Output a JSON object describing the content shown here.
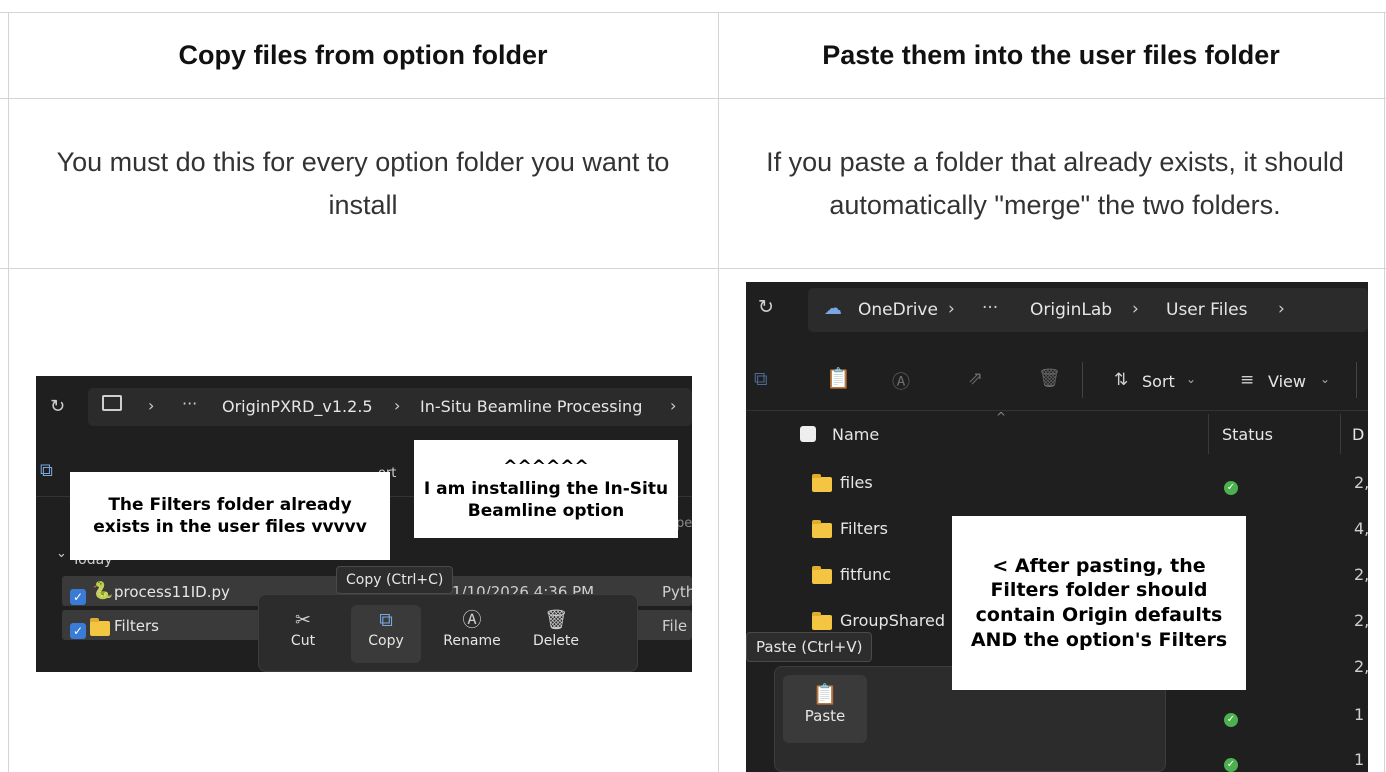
{
  "headers": {
    "left": "Copy files from option folder",
    "right": "Paste them into the user files folder"
  },
  "descriptions": {
    "left": "You must do this for every option folder you want to install",
    "right": "If you paste a folder that already exists, it should automatically \"merge\" the two folders."
  },
  "left_shot": {
    "breadcrumb": [
      "OriginPXRD_v1.2.5",
      "In-Situ Beamline Processing"
    ],
    "ellipsis": "···",
    "refresh_icon": "refresh-icon",
    "monitor_icon": "monitor-icon",
    "group_label": "Today",
    "rows": [
      {
        "name": "process11ID.py",
        "date": "1/10/2026 4:36 PM",
        "type": "Pyth"
      },
      {
        "name": "Filters",
        "date": "",
        "type": "File"
      }
    ],
    "tooltip": "Copy (Ctrl+C)",
    "context_menu": [
      "Cut",
      "Copy",
      "Rename",
      "Delete"
    ],
    "callout_left": "The Filters folder already exists in the user files vvvvv",
    "callout_right": "^^^^^^\nI am installing the In-Situ Beamline option",
    "partial_text": {
      "ort": "ort",
      "pe": "pe"
    }
  },
  "right_shot": {
    "breadcrumb": [
      "OneDrive",
      "OriginLab",
      "User Files"
    ],
    "ellipsis": "···",
    "toolbar": {
      "sort": "Sort",
      "view": "View"
    },
    "columns": {
      "name": "Name",
      "status": "Status",
      "date": "D"
    },
    "rows": [
      {
        "name": "files",
        "status": "ok",
        "date": "2,"
      },
      {
        "name": "Filters",
        "status": "",
        "date": "4,"
      },
      {
        "name": "fitfunc",
        "status": "",
        "date": "2,"
      },
      {
        "name": "GroupShared",
        "status": "",
        "date": "2,"
      },
      {
        "name": "",
        "status": "",
        "date": "2,"
      },
      {
        "name": "",
        "status": "ok",
        "date": "1"
      },
      {
        "name": "",
        "status": "ok",
        "date": "1"
      }
    ],
    "tooltip": "Paste (Ctrl+V)",
    "paste_label": "Paste",
    "callout": "< After pasting, the Filters folder should contain Origin defaults AND the option's Filters"
  }
}
